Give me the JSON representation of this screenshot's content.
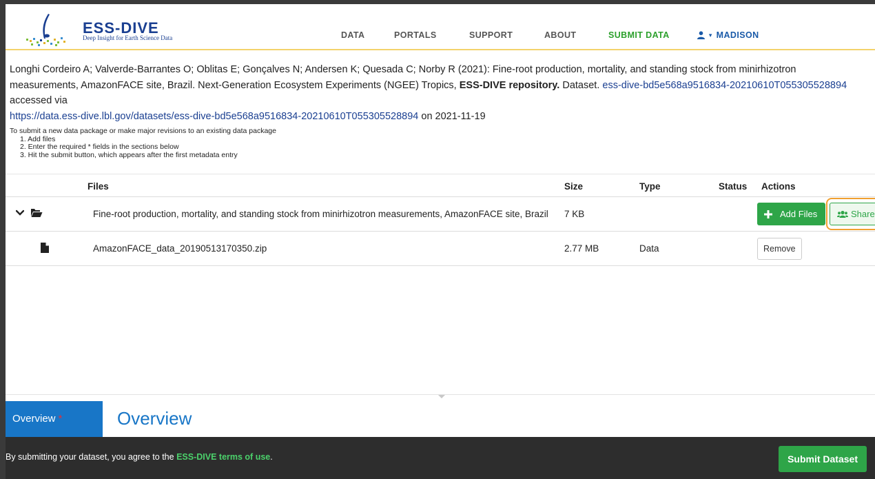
{
  "header": {
    "logo_title": "ESS-DIVE",
    "logo_subtitle": "Deep Insight for Earth Science Data",
    "nav": {
      "data": "DATA",
      "portals": "PORTALS",
      "support": "SUPPORT",
      "about": "ABOUT",
      "submit": "SUBMIT DATA",
      "user": "MADISON"
    },
    "accent_color": "#2ca02c",
    "user_color": "#1a5aa8"
  },
  "citation": {
    "authors_text": "Longhi Cordeiro A; Valverde-Barrantes O; Oblitas E; Gonçalves N; Andersen K; Quesada C; Norby R (2021): Fine-root production, mortality, and standing stock from minirhizotron measurements, AmazonFACE site, Brazil. Next-Generation Ecosystem Experiments (NGEE) Tropics,",
    "repository": "ESS-DIVE repository.",
    "type": "Dataset.",
    "dataset_id": "ess-dive-bd5e568a9516834-20210610T055305528894",
    "accessed_via": "accessed via",
    "url": "https://data.ess-dive.lbl.gov/datasets/ess-dive-bd5e568a9516834-20210610T055305528894",
    "on_date": "on 2021-11-19"
  },
  "instructions": {
    "intro": "To submit a new data package or make major revisions to an existing data package",
    "steps": [
      "1. Add files",
      "2. Enter the required * fields in the sections below",
      "3. Hit the submit button, which appears after the first metadata entry"
    ]
  },
  "table": {
    "headers": {
      "files": "Files",
      "size": "Size",
      "type": "Type",
      "status": "Status",
      "actions": "Actions"
    },
    "rows": [
      {
        "name": "Fine-root production, mortality, and standing stock from minirhizotron measurements, AmazonFACE site, Brazil",
        "size": "7 KB",
        "type": "",
        "status": "",
        "add_files_label": "Add Files",
        "share_label": "Share"
      },
      {
        "name": "AmazonFACE_data_20190513170350.zip",
        "size": "2.77 MB",
        "type": "Data",
        "status": "",
        "remove_label": "Remove"
      }
    ]
  },
  "overview": {
    "tab_label": "Overview",
    "required_marker": "*",
    "title": "Overview"
  },
  "footer": {
    "agreement_text": "By submitting your dataset, you agree to the",
    "terms_link": "ESS-DIVE terms of use",
    "terms_suffix": ".",
    "submit_label": "Submit Dataset"
  }
}
